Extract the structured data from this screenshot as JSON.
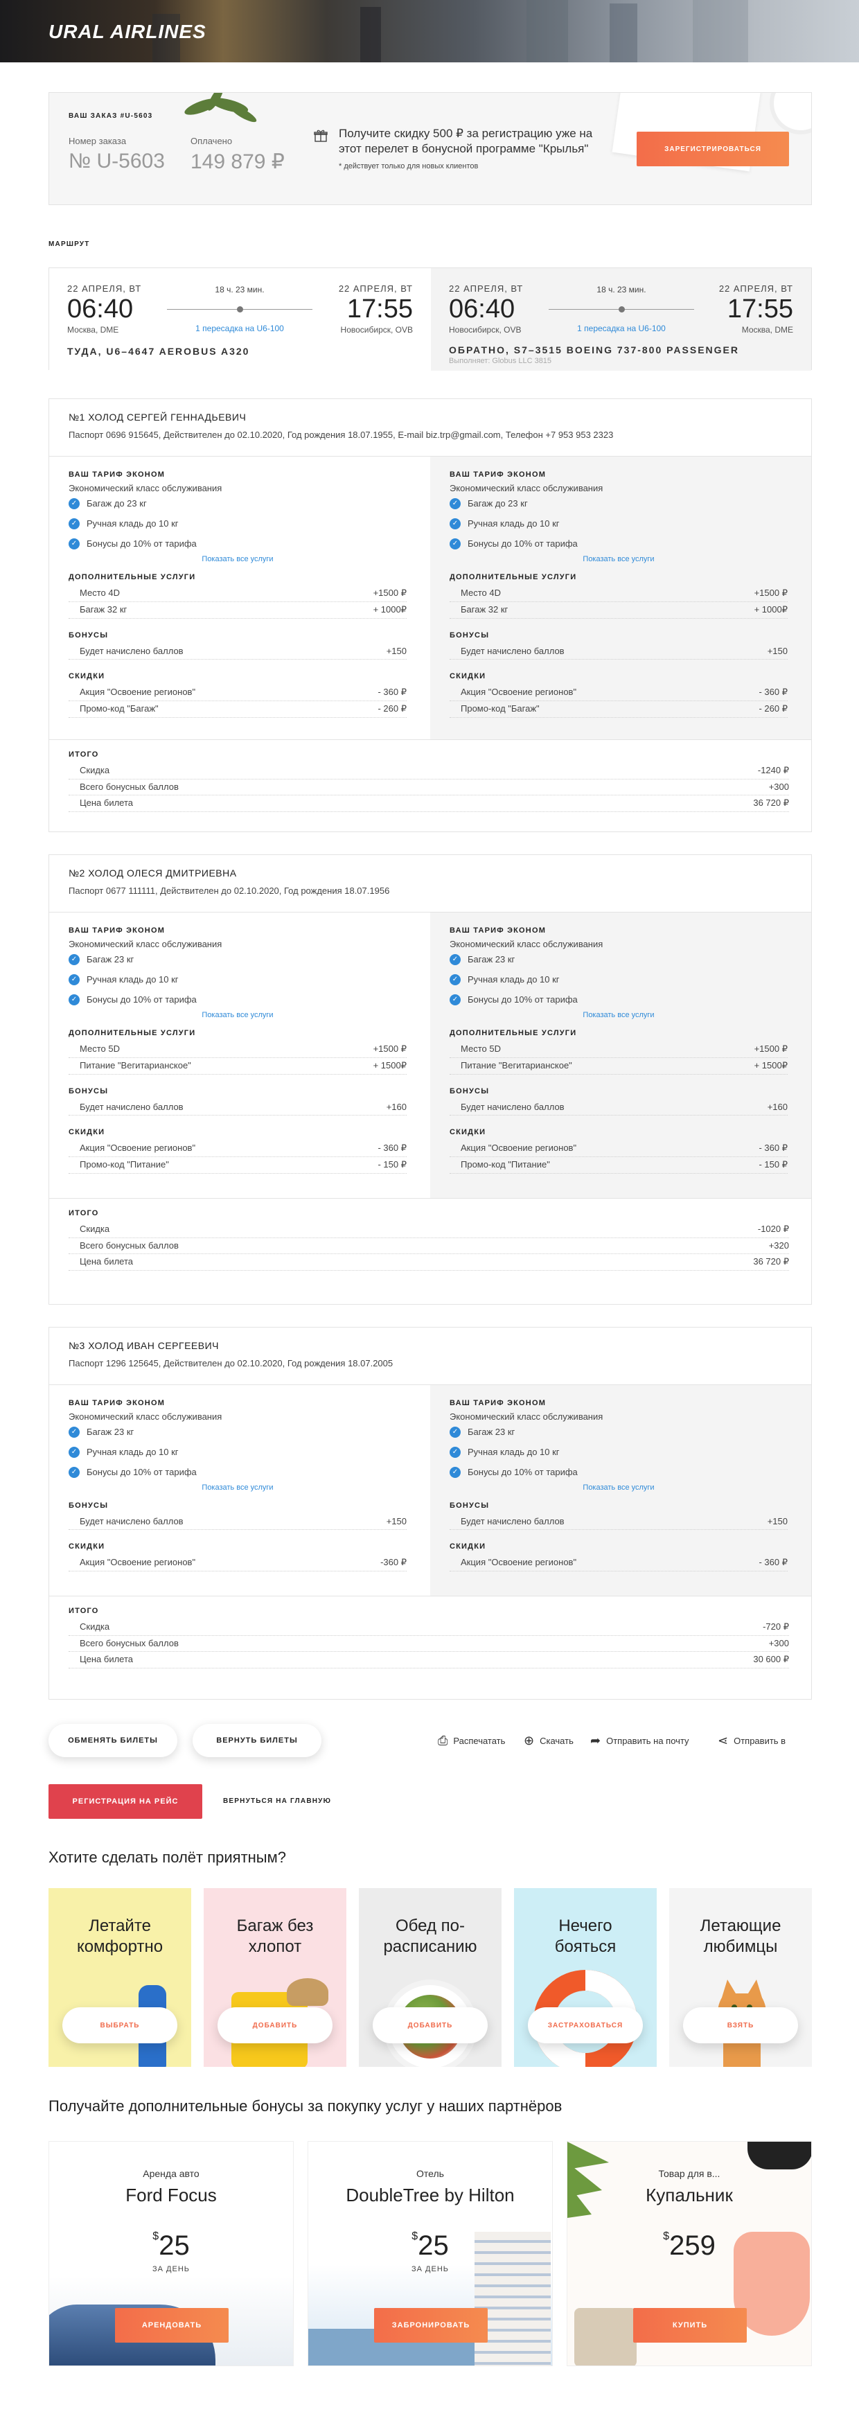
{
  "header": {
    "logo": "URAL AIRLINES"
  },
  "order": {
    "title": "ВАШ ЗАКАЗ #U-5603",
    "number_label": "Номер заказа",
    "number": "№ U-5603",
    "paid_label": "Оплачено",
    "paid": "149 879 ₽",
    "promo": "Получите скидку 500 ₽ за регистрацию уже на этот перелет в бонусной программе \"Крылья\"",
    "promo_note": "* действует только для новых клиентов",
    "register_btn": "ЗАРЕГИСТРИРОВАТЬСЯ"
  },
  "route": {
    "title": "МАРШРУТ",
    "out": {
      "dep_date": "22 АПРЕЛЯ, ВТ",
      "dep_time": "06:40",
      "dep_city": "Москва, DME",
      "duration": "18 ч. 23 мин.",
      "transfer": "1 пересадка на U6-100",
      "arr_date": "22 АПРЕЛЯ, ВТ",
      "arr_time": "17:55",
      "arr_city": "Новосибирск, OVB",
      "flight": "ТУДА, U6–4647 AEROBUS A320",
      "note": ""
    },
    "back": {
      "dep_date": "22 АПРЕЛЯ, ВТ",
      "dep_time": "06:40",
      "dep_city": "Новосибирск, OVB",
      "duration": "18 ч. 23 мин.",
      "transfer": "1 пересадка на U6-100",
      "arr_date": "22 АПРЕЛЯ, ВТ",
      "arr_time": "17:55",
      "arr_city": "Москва, DME",
      "flight": "ОБРАТНО, S7–3515 BOEING 737-800 PASSENGER",
      "note": "Выполняет: Globus LLC 3815"
    }
  },
  "passengers": [
    {
      "name": "№1  ХОЛОД СЕРГЕЙ ГЕННАДЬЕВИЧ",
      "doc": "Паспорт 0696 915645, Действителен до 02.10.2020, Год рождения 18.07.1955, E-mail biz.trp@gmail.com, Телефон +7 953 953 2323",
      "cols": [
        {
          "tariff": "ВАШ ТАРИФ ЭКОНОМ",
          "class": "Экономический класс обслуживания",
          "feats": [
            "Багаж до 23 кг",
            "Ручная кладь до 10 кг",
            "Бонусы до 10% от тарифа"
          ],
          "show_all": "Показать все услуги",
          "extra_h": "ДОПОЛНИТЕЛЬНЫЕ УСЛУГИ",
          "extra": [
            [
              "Место 4D",
              "+1500 ₽"
            ],
            [
              "Багаж 32 кг",
              "+ 1000₽"
            ]
          ],
          "bonus_h": "БОНУСЫ",
          "bonus": [
            [
              "Будет начислено баллов",
              "+150"
            ]
          ],
          "disc_h": "СКИДКИ",
          "disc": [
            [
              "Акция \"Освоение регионов\"",
              "- 360 ₽"
            ],
            [
              "Промо-код \"Багаж\"",
              "- 260 ₽"
            ]
          ]
        },
        {
          "tariff": "ВАШ ТАРИФ ЭКОНОМ",
          "class": "Экономический класс обслуживания",
          "feats": [
            "Багаж до 23 кг",
            "Ручная кладь до 10 кг",
            "Бонусы до 10% от тарифа"
          ],
          "show_all": "Показать все услуги",
          "extra_h": "ДОПОЛНИТЕЛЬНЫЕ УСЛУГИ",
          "extra": [
            [
              "Место 4D",
              "+1500 ₽"
            ],
            [
              "Багаж 32 кг",
              "+ 1000₽"
            ]
          ],
          "bonus_h": "БОНУСЫ",
          "bonus": [
            [
              "Будет начислено баллов",
              "+150"
            ]
          ],
          "disc_h": "СКИДКИ",
          "disc": [
            [
              "Акция \"Освоение регионов\"",
              "- 360 ₽"
            ],
            [
              "Промо-код \"Багаж\"",
              "- 260 ₽"
            ]
          ]
        }
      ],
      "total_h": "ИТОГО",
      "total": [
        [
          "Скидка",
          "-1240 ₽"
        ],
        [
          "Всего бонусных баллов",
          "+300"
        ],
        [
          "Цена билета",
          "36 720 ₽"
        ]
      ]
    },
    {
      "name": "№2  ХОЛОД ОЛЕСЯ ДМИТРИЕВНА",
      "doc": "Паспорт 0677 111111, Действителен до 02.10.2020, Год рождения 18.07.1956",
      "cols": [
        {
          "tariff": "ВАШ ТАРИФ ЭКОНОМ",
          "class": "Экономический класс обслуживания",
          "feats": [
            "Багаж 23 кг",
            "Ручная кладь до 10 кг",
            "Бонусы до 10% от тарифа"
          ],
          "show_all": "Показать все услуги",
          "extra_h": "ДОПОЛНИТЕЛЬНЫЕ УСЛУГИ",
          "extra": [
            [
              "Место 5D",
              "+1500 ₽"
            ],
            [
              "Питание \"Вегитарианское\"",
              "+ 1500₽"
            ]
          ],
          "bonus_h": "БОНУСЫ",
          "bonus": [
            [
              "Будет начислено баллов",
              "+160"
            ]
          ],
          "disc_h": "СКИДКИ",
          "disc": [
            [
              "Акция \"Освоение регионов\"",
              "- 360 ₽"
            ],
            [
              "Промо-код \"Питание\"",
              "- 150 ₽"
            ]
          ]
        },
        {
          "tariff": "ВАШ ТАРИФ ЭКОНОМ",
          "class": "Экономический класс обслуживания",
          "feats": [
            "Багаж 23 кг",
            "Ручная кладь до 10 кг",
            "Бонусы до 10% от тарифа"
          ],
          "show_all": "Показать все услуги",
          "extra_h": "ДОПОЛНИТЕЛЬНЫЕ УСЛУГИ",
          "extra": [
            [
              "Место 5D",
              "+1500 ₽"
            ],
            [
              "Питание \"Вегитарианское\"",
              "+ 1500₽"
            ]
          ],
          "bonus_h": "БОНУСЫ",
          "bonus": [
            [
              "Будет начислено баллов",
              "+160"
            ]
          ],
          "disc_h": "СКИДКИ",
          "disc": [
            [
              "Акция \"Освоение регионов\"",
              "- 360 ₽"
            ],
            [
              "Промо-код \"Питание\"",
              "- 150 ₽"
            ]
          ]
        }
      ],
      "total_h": "ИТОГО",
      "total": [
        [
          "Скидка",
          "-1020 ₽"
        ],
        [
          "Всего бонусных баллов",
          "+320"
        ],
        [
          "Цена билета",
          "36 720 ₽"
        ]
      ]
    },
    {
      "name": "№3  ХОЛОД ИВАН СЕРГЕЕВИЧ",
      "doc": "Паспорт 1296 125645, Действителен до 02.10.2020, Год рождения 18.07.2005",
      "cols": [
        {
          "tariff": "ВАШ ТАРИФ ЭКОНОМ",
          "class": "Экономический класс обслуживания",
          "feats": [
            "Багаж 23 кг",
            "Ручная кладь до 10 кг",
            "Бонусы до 10% от тарифа"
          ],
          "show_all": "Показать все услуги",
          "extra_h": "",
          "extra": [],
          "bonus_h": "БОНУСЫ",
          "bonus": [
            [
              "Будет начислено баллов",
              "+150"
            ]
          ],
          "disc_h": "СКИДКИ",
          "disc": [
            [
              "Акция \"Освоение регионов\"",
              "-360 ₽"
            ]
          ]
        },
        {
          "tariff": "ВАШ ТАРИФ ЭКОНОМ",
          "class": "Экономический класс обслуживания",
          "feats": [
            "Багаж 23 кг",
            "Ручная кладь до 10 кг",
            "Бонусы до 10% от тарифа"
          ],
          "show_all": "Показать все услуги",
          "extra_h": "",
          "extra": [],
          "bonus_h": "БОНУСЫ",
          "bonus": [
            [
              "Будет начислено баллов",
              "+150"
            ]
          ],
          "disc_h": "СКИДКИ",
          "disc": [
            [
              "Акция \"Освоение регионов\"",
              "- 360 ₽"
            ]
          ]
        }
      ],
      "total_h": "ИТОГО",
      "total": [
        [
          "Скидка",
          "-720 ₽"
        ],
        [
          "Всего бонусных баллов",
          "+300"
        ],
        [
          "Цена билета",
          "30 600 ₽"
        ]
      ]
    }
  ],
  "actions": {
    "exchange": "ОБМЕНЯТЬ БИЛЕТЫ",
    "refund": "ВЕРНУТЬ БИЛЕТЫ",
    "print": "Распечатать",
    "download": "Скачать",
    "email": "Отправить на почту",
    "share": "Отправить в",
    "checkin": "РЕГИСТРАЦИЯ НА РЕЙС",
    "home": "ВЕРНУТЬСЯ НА ГЛАВНУЮ"
  },
  "services": {
    "title": "Хотите сделать полёт приятным?",
    "items": [
      {
        "title": "Летайте комфортно",
        "btn": "ВЫБРАТЬ"
      },
      {
        "title": "Багаж без хлопот",
        "btn": "ДОБАВИТЬ"
      },
      {
        "title": "Обед по-расписанию",
        "btn": "ДОБАВИТЬ"
      },
      {
        "title": "Нечего бояться",
        "btn": "ЗАСТРАХОВАТЬСЯ"
      },
      {
        "title": "Летающие любимцы",
        "btn": "ВЗЯТЬ"
      }
    ]
  },
  "partners": {
    "title": "Получайте дополнительные бонусы за покупку услуг у наших партнёров",
    "items": [
      {
        "sub": "Аренда авто",
        "name": "Ford Focus",
        "cur": "$",
        "price": "25",
        "unit": "ЗА ДЕНЬ",
        "btn": "АРЕНДОВАТЬ"
      },
      {
        "sub": "Отель",
        "name": "DoubleTree by Hilton",
        "cur": "$",
        "price": "25",
        "unit": "ЗА ДЕНЬ",
        "btn": "ЗАБРОНИРОВАТЬ"
      },
      {
        "sub": "Товар для в...",
        "name": "Купальник",
        "cur": "$",
        "price": "259",
        "unit": "",
        "btn": "КУПИТЬ"
      }
    ]
  }
}
